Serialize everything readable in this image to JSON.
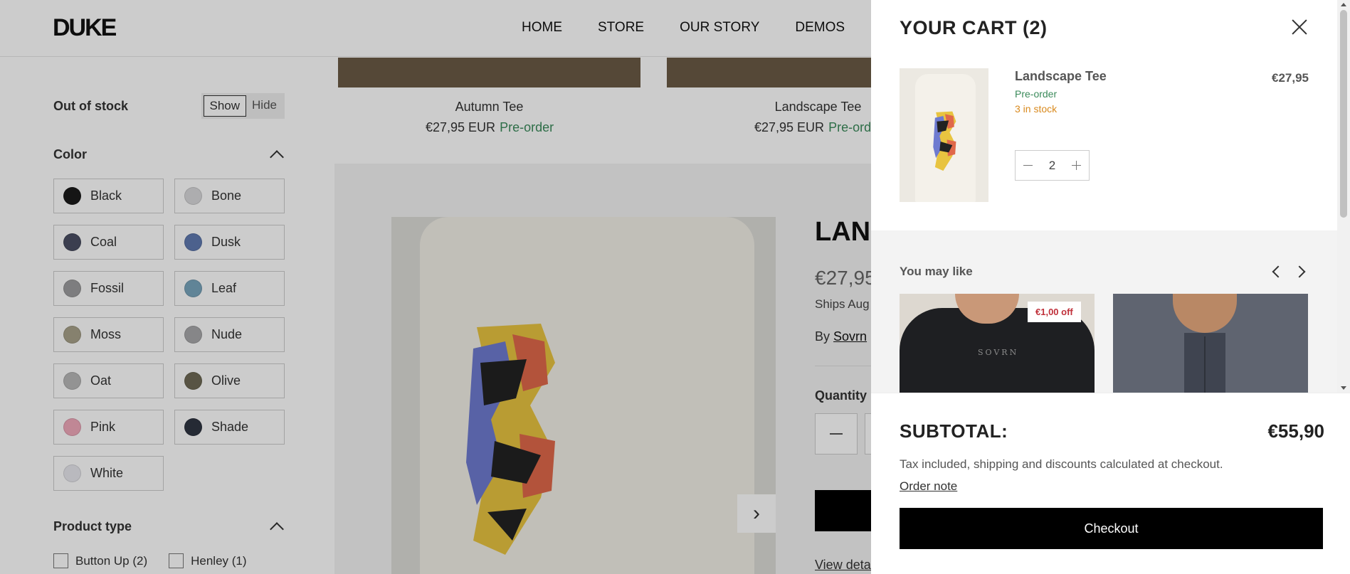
{
  "header": {
    "logo": "DUKE",
    "nav": [
      "HOME",
      "STORE",
      "OUR STORY",
      "DEMOS"
    ]
  },
  "sidebar": {
    "out_of_stock_label": "Out of stock",
    "oos_show": "Show",
    "oos_hide": "Hide",
    "color_heading": "Color",
    "colors": [
      {
        "name": "Black",
        "hex": "#1b1b1b"
      },
      {
        "name": "Bone",
        "hex": "#d9d9db"
      },
      {
        "name": "Coal",
        "hex": "#4a4e63"
      },
      {
        "name": "Dusk",
        "hex": "#5f7ab1"
      },
      {
        "name": "Fossil",
        "hex": "#9d9d9f"
      },
      {
        "name": "Leaf",
        "hex": "#79a5bd"
      },
      {
        "name": "Moss",
        "hex": "#a8a28a"
      },
      {
        "name": "Nude",
        "hex": "#a8a8aa"
      },
      {
        "name": "Oat",
        "hex": "#b8b8b8"
      },
      {
        "name": "Olive",
        "hex": "#6f6a55"
      },
      {
        "name": "Pink",
        "hex": "#f0a9bb"
      },
      {
        "name": "Shade",
        "hex": "#2f3542"
      },
      {
        "name": "White",
        "hex": "#e8e8ee"
      }
    ],
    "product_type_heading": "Product type",
    "product_types": [
      "Button Up (2)",
      "Henley (1)"
    ]
  },
  "products": [
    {
      "name": "Autumn Tee",
      "price": "€27,95 EUR",
      "status": "Pre-order"
    },
    {
      "name": "Landscape Tee",
      "price": "€27,95 EUR",
      "status": "Pre-ord"
    }
  ],
  "quick_view": {
    "title": "LAN",
    "price": "€27,95",
    "ships": "Ships Aug",
    "by_label": "By",
    "brand": "Sovrn",
    "quantity_label": "Quantity",
    "view_details": "View detai"
  },
  "cart": {
    "title": "YOUR CART (2)",
    "item": {
      "name": "Landscape Tee",
      "status": "Pre-order",
      "stock": "3 in stock",
      "price": "€27,95",
      "quantity": "2"
    },
    "you_may_like": "You may like",
    "recommendation_badge": "€1,00 off",
    "recommendation_mark": "SOVRN",
    "subtotal_label": "SUBTOTAL:",
    "subtotal_value": "€55,90",
    "tax_note": "Tax included, shipping and discounts calculated at checkout.",
    "order_note": "Order note",
    "checkout_label": "Checkout"
  },
  "colors": {
    "preorder_green": "#3a8a5a",
    "stock_orange": "#d98a1e",
    "badge_red": "#c0303a",
    "checkout_bg": "#000000"
  }
}
